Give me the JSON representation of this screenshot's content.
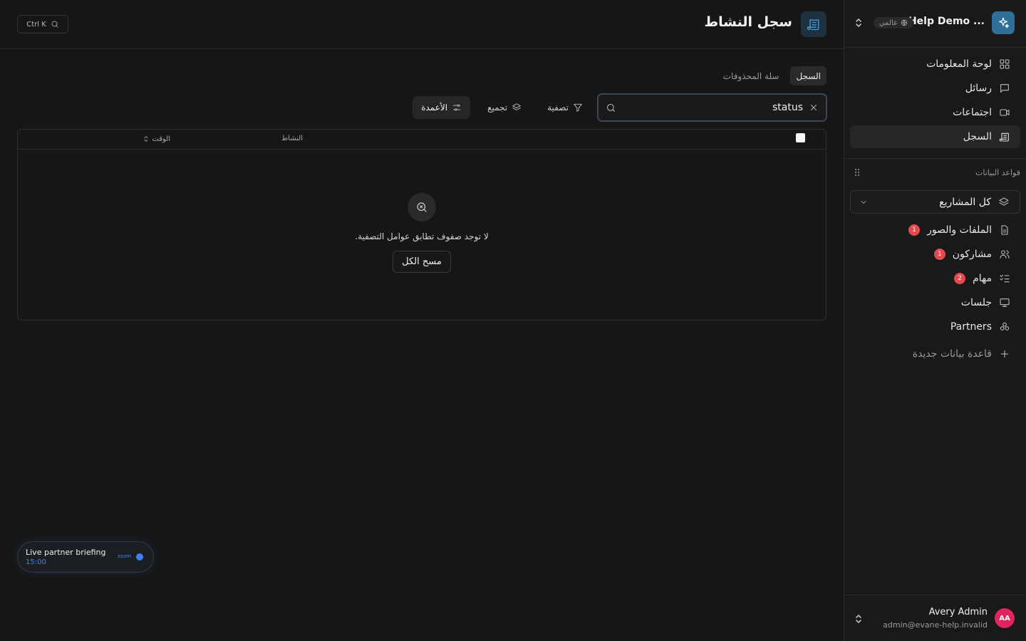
{
  "workspace": {
    "name": "Help Demo ...",
    "scope_badge": "عالمي"
  },
  "nav": {
    "items": [
      {
        "label": "لوحة المعلومات",
        "icon": "dashboard-icon"
      },
      {
        "label": "رسائل",
        "icon": "message-icon"
      },
      {
        "label": "اجتماعات",
        "icon": "video-icon"
      },
      {
        "label": "السجل",
        "icon": "log-icon",
        "active": true
      }
    ]
  },
  "databases": {
    "title": "قواعد البيانات",
    "project_select": "كل المشاريع",
    "items": [
      {
        "label": "الملفات والصور",
        "count": "1",
        "icon": "file-icon"
      },
      {
        "label": "مشاركون",
        "count": "1",
        "icon": "users-icon"
      },
      {
        "label": "مهام",
        "count": "2",
        "icon": "tasks-icon"
      },
      {
        "label": "جلسات",
        "count": "",
        "icon": "presentation-icon"
      },
      {
        "label": "Partners",
        "count": "",
        "icon": "partners-icon"
      }
    ],
    "new_label": "قاعدة بيانات جديدة"
  },
  "user": {
    "initials": "AA",
    "name": "Avery Admin",
    "email": "admin@evane-help.invalid"
  },
  "page": {
    "title": "سجل النشاط",
    "shortcut": "Ctrl K"
  },
  "tabs": [
    {
      "label": "السجل",
      "active": true
    },
    {
      "label": "سلة المحذوفات",
      "active": false
    }
  ],
  "search": {
    "value": "status"
  },
  "toolbar": {
    "filter_label": "تصفية",
    "group_label": "تجميع",
    "columns_label": "الأعمدة"
  },
  "table": {
    "columns": [
      "النشاط",
      "الوقت"
    ],
    "empty_text": "لا توجد صفوف تطابق عوامل التصفية.",
    "clear_label": "مسح الكل"
  },
  "meeting": {
    "title": "Live partner briefing",
    "time": "15:00",
    "provider": "zoom"
  },
  "colors": {
    "accent": "#3b82f6",
    "logo": "#2f6f9a",
    "badge": "#e5484d",
    "avatar": "#e0245e"
  }
}
